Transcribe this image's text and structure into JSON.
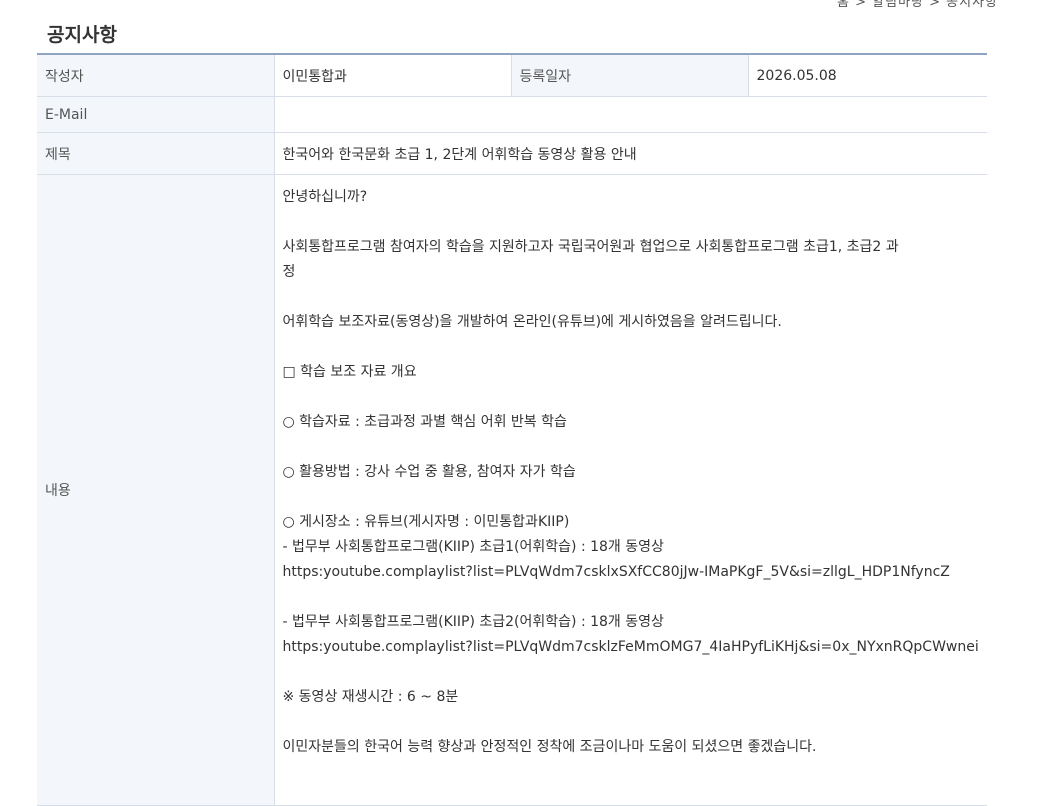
{
  "page": {
    "title": "공지사항",
    "top_cut_text": "홈 > 알림마당 > 공지사항"
  },
  "labels": {
    "author": "작성자",
    "date": "등록일자",
    "email": "E-Mail",
    "subject": "제목",
    "content": "내용"
  },
  "post": {
    "author": "이민통합과",
    "date": "2026.05.08",
    "email": "",
    "subject": "한국어와 한국문화 초급 1, 2단계 어휘학습 동영상 활용 안내",
    "content": {
      "greeting": "안녕하십니까?",
      "intro1_a": "사회통합프로그램 참여자의 학습을 지원하고자 국립국어원과 협업으로 사회통합프로그램 초급1, 초급2 과",
      "intro1_b": "정",
      "intro2": "어휘학습 보조자료(동영상)을 개발하여 온라인(유튜브)에 게시하였음을 알려드립니다.",
      "section_head": "□ 학습 보조 자료 개요",
      "item1": "○ 학습자료 : 초급과정 과별 핵심 어휘 반복 학습",
      "item2": "○ 활용방법 : 강사 수업 중 활용, 참여자 자가 학습",
      "item3": "○ 게시장소 : 유튜브(게시자명 : 이민통합과KIIP)",
      "link1_label": "- 법무부 사회통합프로그램(KIIP) 초급1(어휘학습) : 18개 동영상",
      "link1_url": "https:youtube.complaylist?list=PLVqWdm7csklxSXfCC80jJw-IMaPKgF_5V&si=zllgL_HDP1NfyncZ",
      "link2_label": "- 법무부 사회통합프로그램(KIIP) 초급2(어휘학습) : 18개 동영상",
      "link2_url": "https:youtube.complaylist?list=PLVqWdm7csklzFeMmOMG7_4IaHPyfLiKHj&si=0x_NYxnRQpCWwnei",
      "note": "※ 동영상 재생시간 : 6 ~ 8분",
      "closing": "이민자분들의 한국어 능력 향상과 안정적인 정착에 조금이나마 도움이 되셨으면 좋겠습니다."
    }
  }
}
